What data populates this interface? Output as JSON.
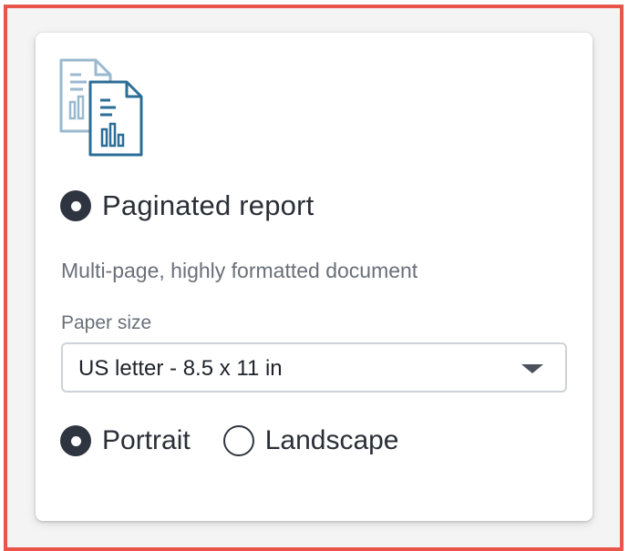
{
  "report_type": {
    "label": "Paginated report",
    "selected": true,
    "description": "Multi-page, highly formatted document",
    "icon": "paginated-report-document-icon"
  },
  "paper_size": {
    "label": "Paper size",
    "value": "US letter - 8.5 x 11 in"
  },
  "orientation": {
    "options": [
      {
        "label": "Portrait",
        "selected": true
      },
      {
        "label": "Landscape",
        "selected": false
      }
    ]
  },
  "colors": {
    "highlight_border": "#e8564b",
    "icon_back_document": "#9ab9cf",
    "icon_front_document": "#2a6d96",
    "radio_selected": "#2f3540"
  }
}
